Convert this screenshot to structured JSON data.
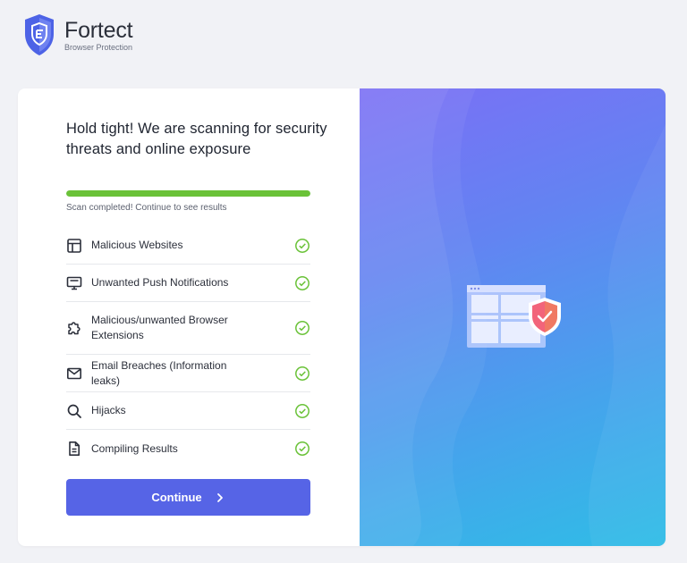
{
  "brand": {
    "name": "Fortect",
    "subtitle": "Browser Protection",
    "icon": "fortect-shield-icon"
  },
  "scan": {
    "headline": "Hold tight! We are scanning for security threats and online exposure",
    "progress": 1.0,
    "status": "Scan completed! Continue to see results",
    "items": [
      {
        "label": "Malicious Websites",
        "icon": "browser-layout-icon",
        "status": "complete"
      },
      {
        "label": "Unwanted Push Notifications",
        "icon": "monitor-icon",
        "status": "complete"
      },
      {
        "label": "Malicious/unwanted Browser Extensions",
        "icon": "puzzle-icon",
        "status": "complete"
      },
      {
        "label": "Email Breaches (Information leaks)",
        "icon": "mail-icon",
        "status": "complete"
      },
      {
        "label": "Hijacks",
        "icon": "search-icon",
        "status": "complete"
      },
      {
        "label": "Compiling Results",
        "icon": "document-icon",
        "status": "complete"
      }
    ],
    "continue_label": "Continue"
  },
  "colors": {
    "accent": "#5664e6",
    "success": "#6ac238",
    "gradient_top": "#7b6ff5",
    "gradient_bottom": "#2fbde6"
  }
}
